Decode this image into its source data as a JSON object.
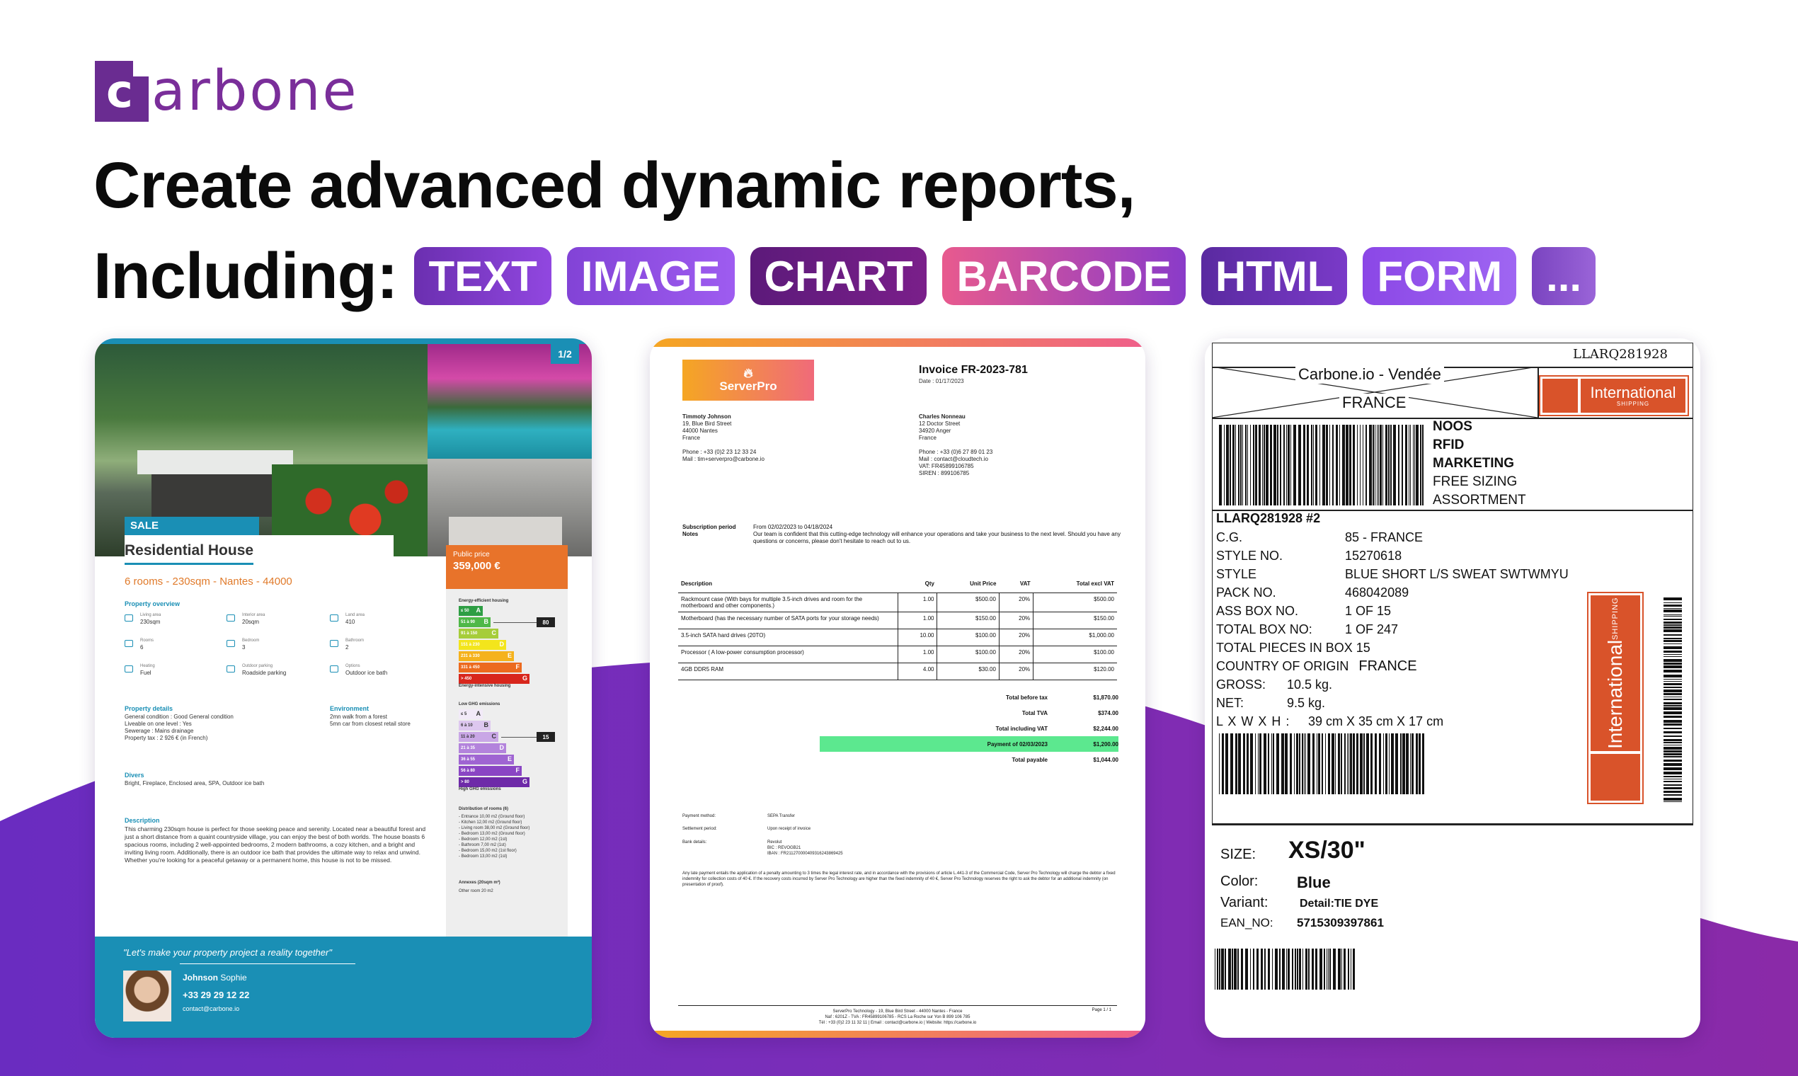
{
  "brand": {
    "name": "arbone",
    "mark_letter": "c",
    "color": "#6a2c91"
  },
  "headline": {
    "line1": "Create advanced dynamic reports,",
    "line2_label": "Including:",
    "chips": [
      "TEXT",
      "IMAGE",
      "CHART",
      "BARCODE",
      "HTML",
      "FORM",
      "..."
    ]
  },
  "real_estate": {
    "page": "1/2",
    "badge": "SALE",
    "title": "Residential House",
    "subtitle": "6 rooms - 230sqm - Nantes - 44000",
    "overview_heading": "Property overview",
    "overview": [
      {
        "label": "Living area",
        "value": "230sqm",
        "icon": "area-icon"
      },
      {
        "label": "Interior area",
        "value": "20sqm",
        "icon": "interior-icon"
      },
      {
        "label": "Land area",
        "value": "410",
        "icon": "land-icon"
      },
      {
        "label": "Rooms",
        "value": "6",
        "icon": "door-icon"
      },
      {
        "label": "Bedroom",
        "value": "3",
        "icon": "bed-icon"
      },
      {
        "label": "Bathroom",
        "value": "2",
        "icon": "bath-icon"
      },
      {
        "label": "Heating",
        "value": "Fuel",
        "icon": "heating-icon"
      },
      {
        "label": "Outdoor parking",
        "value": "Roadside parking",
        "icon": "car-icon"
      },
      {
        "label": "Options",
        "value": "Outdoor ice bath",
        "icon": "options-icon"
      }
    ],
    "details_heading": "Property details",
    "details": [
      "General condition : Good General condition",
      "Liveable on one level : Yes",
      "Sewerage : Mains drainage",
      "Property tax : 2 926 € (in French)"
    ],
    "environment_heading": "Environment",
    "environment": [
      "2mn walk from a forest",
      "5mn car from closest retail store"
    ],
    "divers_heading": "Divers",
    "divers": "Bright, Fireplace, Enclosed area, SPA, Outdoor ice bath",
    "description_heading": "Description",
    "description": "This charming 230sqm house is perfect for those seeking peace and serenity. Located near a beautiful forest and just a short distance from a quaint countryside village, you can enjoy the best of both worlds. The house boasts 6 spacious rooms, including 2 well-appointed bedrooms, 2 modern bathrooms, a cozy kitchen, and a bright and inviting living room. Additionally, there is an outdoor ice bath that provides the ultimate way to relax and unwind. Whether you're looking for a peaceful getaway or a permanent home, this house is not to be missed.",
    "price_label": "Public price",
    "price_value": "359,000 €",
    "energy_heading": "Energy-efficient housing",
    "energy_footer": "Energy-intensive housing",
    "energy_value": "80",
    "energy_classes": [
      {
        "range": "≤ 50",
        "letter": "A",
        "color": "#2e9e44"
      },
      {
        "range": "51 à 90",
        "letter": "B",
        "color": "#4fb848"
      },
      {
        "range": "91 à 150",
        "letter": "C",
        "color": "#a6cd3a"
      },
      {
        "range": "151 à 230",
        "letter": "D",
        "color": "#f3e51c"
      },
      {
        "range": "231 à 330",
        "letter": "E",
        "color": "#f5b21c"
      },
      {
        "range": "331 à 450",
        "letter": "F",
        "color": "#ec6a1e"
      },
      {
        "range": "> 450",
        "letter": "G",
        "color": "#d8261c"
      }
    ],
    "ghg_heading": "Low GHG emissions",
    "ghg_footer": "High GHG emissions",
    "ghg_value": "15",
    "ghg_classes": [
      {
        "range": "≤ 5",
        "letter": "A",
        "color": "#f2eaf8"
      },
      {
        "range": "6 à 10",
        "letter": "B",
        "color": "#ddc7ef"
      },
      {
        "range": "11 à 20",
        "letter": "C",
        "color": "#c9a7e6"
      },
      {
        "range": "21 à 35",
        "letter": "D",
        "color": "#b383dc"
      },
      {
        "range": "36 à 55",
        "letter": "E",
        "color": "#9f64d2"
      },
      {
        "range": "56 à 80",
        "letter": "F",
        "color": "#8a45c4"
      },
      {
        "range": "> 80",
        "letter": "G",
        "color": "#6e2aa8"
      }
    ],
    "rooms_heading": "Distribution of rooms (6)",
    "rooms": [
      "- Entrance 10,00 m2 (Ground floor)",
      "- Kitchen 12,00 m2 (Ground floor)",
      "- Living room 38,00 m2 (Ground floor)",
      "- Bedroom 13,00 m2 (Ground floor)",
      "- Bedroom 12,00 m2 (1st)",
      "- Bathroom 7,00 m2 (1st)",
      "- Bedroom 15,00 m2 (1st floor)",
      "- Bedroom 13,00 m2 (1st)"
    ],
    "annex_heading": "Annexes (20sqm m²)",
    "annex": "Other room 20 m2",
    "quote": "\"Let's make your property project a reality together\"",
    "agent_first": "Johnson",
    "agent_last": "Sophie",
    "agent_phone": "+33 29 29 12 22",
    "agent_mail": "contact@carbone.io"
  },
  "invoice": {
    "logo": "ServerPro",
    "title": "Invoice FR-2023-781",
    "date": "Date : 01/17/2023",
    "from": [
      "Timmoty Johnson",
      "19, Blue Bird Street",
      "44000 Nantes",
      "France",
      "",
      "Phone : +33 (0)2 23 12 33 24",
      "Mail : tim+serverpro@carbone.io"
    ],
    "to": [
      "Charles Nonneau",
      "12 Doctor Street",
      "34920 Anger",
      "France",
      "",
      "Phone : +33 (0)6 27 89 01 23",
      "Mail : contact@cloudtech.io",
      "VAT: FR45899106785",
      "SIREN : 899106785"
    ],
    "period_label": "Subscription period",
    "period_value": "From 02/02/2023 to 04/18/2024",
    "notes_label": "Notes",
    "notes_value": "Our team is confident that this cutting-edge technology will enhance your operations and take your business to the next level. Should you have any questions or concerns, please don't hesitate to reach out to us.",
    "columns": [
      "Description",
      "Qty",
      "Unit Price",
      "VAT",
      "Total excl VAT"
    ],
    "rows": [
      [
        "Rackmount case (With bays for multiple 3.5-inch drives and room for the motherboard and other components.)",
        "1.00",
        "$500.00",
        "20%",
        "$500.00"
      ],
      [
        "Motherboard (has the necessary number of SATA ports for your storage needs)",
        "1.00",
        "$150.00",
        "20%",
        "$150.00"
      ],
      [
        "3.5-inch SATA hard drives (20TO)",
        "10.00",
        "$100.00",
        "20%",
        "$1,000.00"
      ],
      [
        "Processor ( A low-power consumption processor)",
        "1.00",
        "$100.00",
        "20%",
        "$100.00"
      ],
      [
        "4GB DDR5 RAM",
        "4.00",
        "$30.00",
        "20%",
        "$120.00"
      ]
    ],
    "totals": [
      {
        "label": "Total before tax",
        "value": "$1,870.00"
      },
      {
        "label": "Total TVA",
        "value": "$374.00"
      },
      {
        "label": "Total including VAT",
        "value": "$2,244.00"
      },
      {
        "label": "Payment of 02/03/2023",
        "value": "$1,200.00"
      },
      {
        "label": "Total payable",
        "value": "$1,044.00"
      }
    ],
    "payment_method_label": "Payment method:",
    "payment_method": "SEPA Transfer",
    "settlement_label": "Settlement period:",
    "settlement": "Upon receipt of invoice",
    "bank_label": "Bank details:",
    "bank": [
      "Revolut",
      "BIC : REVOGB21",
      "IBAN : FR211270000409316243869425"
    ],
    "legal": "Any late payment entails the application of a penalty amounting to 3 times the legal interest rate, and in accordance with the provisions of article L.441-3 of the Commercial Code, Server Pro Technology will charge the debtor a fixed indemnity for collection costs of 40 €. If the recovery costs incurred by Server Pro Technology are higher than the fixed indemnity of 40 €, Server Pro Technology reserves the right to ask the debtor for an additional indemnity (on presentation of proof).",
    "footer": [
      "ServerPro Technology - 19, Blue Bird Street - 44000 Nantes - France",
      "Naf : 6201Z - TVA : FR45899106785 - RCS La Roche sur Yon B 899 106 785",
      "Tél : +33 (0)2 23 11 32 11 | Email : contact@carbone.io | Website: https://carbone.io"
    ],
    "page": "Page 1 / 1"
  },
  "label": {
    "tracking": "LLARQ281928",
    "from_line1": "Carbone.io - Vendée",
    "from_line2": "FRANCE",
    "intl_text": "International",
    "intl_sub": "SHIPPING",
    "tags": [
      "NOOS",
      "RFID",
      "MARKETING",
      "FREE SIZING",
      "ASSORTMENT"
    ],
    "box_id": "LLARQ281928 #2",
    "fields": [
      {
        "k": "C.G.",
        "v": "85   -   FRANCE"
      },
      {
        "k": "STYLE NO.",
        "v": "15270618"
      },
      {
        "k": "STYLE",
        "v": "BLUE SHORT L/S SWEAT SWTWMYU"
      },
      {
        "k": "PACK NO.",
        "v": "468042089"
      },
      {
        "k": "ASS BOX NO.",
        "v": "1 OF 15"
      },
      {
        "k": "TOTAL BOX NO:",
        "v": "1 OF 247"
      }
    ],
    "pieces": "TOTAL PIECES IN BOX    15",
    "origin_label": "COUNTRY OF ORIGIN",
    "origin": "FRANCE",
    "gross_label": "GROSS:",
    "gross": "10.5 kg.",
    "net_label": "NET:",
    "net": "9.5 kg.",
    "dims_label": "L X W X H :",
    "dims": "39 cm X 35 cm X 17 cm",
    "size_label": "SIZE:",
    "size": "XS/30\"",
    "color_label": "Color:",
    "color": "Blue",
    "variant_label": "Variant:",
    "variant": "Detail:TIE DYE",
    "ean_label": "EAN_NO:",
    "ean": "5715309397861"
  }
}
